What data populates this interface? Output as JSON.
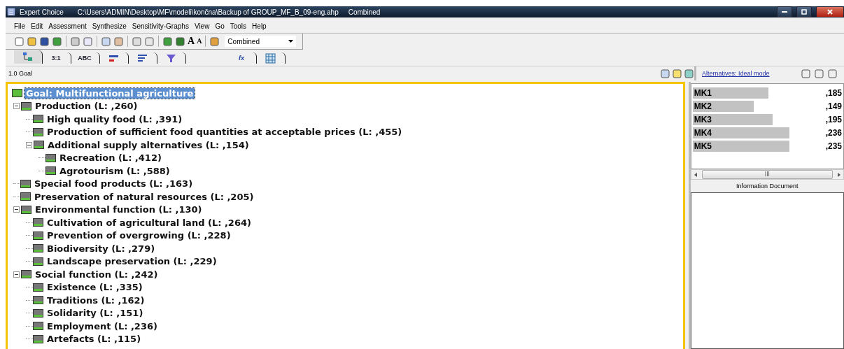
{
  "window": {
    "app": "Expert Choice",
    "path": "C:\\Users\\ADMIN\\Desktop\\MF\\modeli\\končna\\Backup of GROUP_MF_B_09-eng.ahp",
    "mode": "Combined"
  },
  "menu": [
    "File",
    "Edit",
    "Assessment",
    "Synthesize",
    "Sensitivity-Graphs",
    "View",
    "Go",
    "Tools",
    "Help"
  ],
  "toolbar": {
    "combo_value": "Combined",
    "font_bigger": "A",
    "font_smaller": "A"
  },
  "tabs": [
    {
      "kind": "tree",
      "selected": true
    },
    {
      "kind": "text",
      "label": "3:1",
      "selected": false
    },
    {
      "kind": "text",
      "label": "ABC",
      "selected": false
    },
    {
      "kind": "bars",
      "selected": false
    },
    {
      "kind": "lines",
      "selected": false
    },
    {
      "kind": "funnel",
      "selected": false
    },
    {
      "kind": "formula",
      "label": "fx",
      "selected": false
    },
    {
      "kind": "grid",
      "selected": false
    }
  ],
  "breadcrumb": "1.0 Goal",
  "tree": {
    "label": "Goal: Multifunctional agriculture",
    "selected": true,
    "children": [
      {
        "label": "Production (L: ,260)",
        "expanded": true,
        "children": [
          {
            "label": "High quality food (L: ,391)"
          },
          {
            "label": "Production of sufficient food quantities at acceptable prices (L: ,455)"
          },
          {
            "label": "Additional supply alternatives (L: ,154)",
            "expanded": true,
            "children": [
              {
                "label": "Recreation (L: ,412)"
              },
              {
                "label": "Agrotourism (L: ,588)"
              }
            ]
          }
        ]
      },
      {
        "label": "Special food products (L: ,163)"
      },
      {
        "label": "Preservation of natural resources (L: ,205)"
      },
      {
        "label": "Environmental function (L: ,130)",
        "expanded": true,
        "children": [
          {
            "label": "Cultivation of agricultural land (L: ,264)"
          },
          {
            "label": "Prevention of overgrowing (L: ,228)"
          },
          {
            "label": "Biodiversity (L: ,279)"
          },
          {
            "label": "Landscape preservation (L: ,229)"
          }
        ]
      },
      {
        "label": "Social function (L: ,242)",
        "expanded": true,
        "children": [
          {
            "label": "Existence (L: ,335)"
          },
          {
            "label": "Traditions (L: ,162)"
          },
          {
            "label": "Solidarity (L: ,151)"
          },
          {
            "label": "Employment (L: ,236)"
          },
          {
            "label": "Artefacts (L: ,115)"
          }
        ]
      }
    ]
  },
  "alternatives": {
    "link": "Alternatives: Ideal mode",
    "items": [
      {
        "name": "MK1",
        "value": ",185"
      },
      {
        "name": "MK2",
        "value": ",149"
      },
      {
        "name": "MK3",
        "value": ",195"
      },
      {
        "name": "MK4",
        "value": ",236"
      },
      {
        "name": "MK5",
        "value": ",235"
      }
    ],
    "scroll_grip": "III",
    "document_title": "Information Document"
  }
}
